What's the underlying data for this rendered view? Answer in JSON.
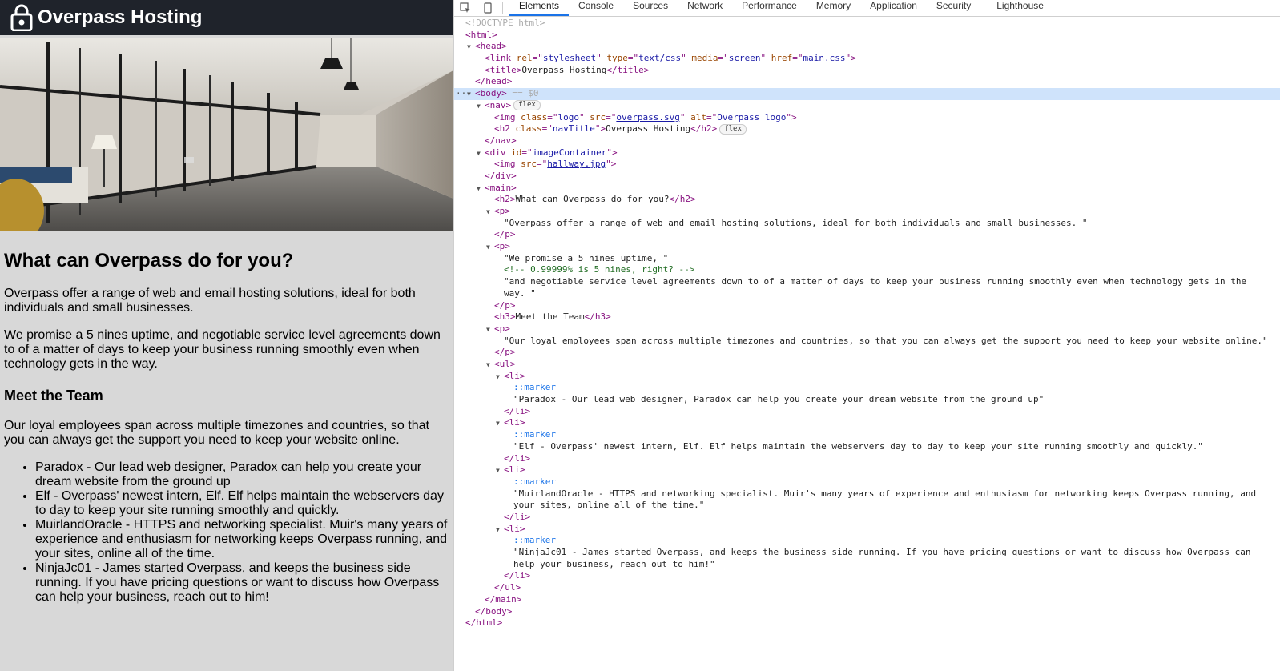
{
  "site": {
    "nav_title": "Overpass Hosting",
    "heading": "What can Overpass do for you?",
    "intro": "Overpass offer a range of web and email hosting solutions, ideal for both individuals and small businesses.",
    "promise": "We promise a 5 nines uptime, and negotiable service level agreements down to of a matter of days to keep your business running smoothly even when technology gets in the way.",
    "team_heading": "Meet the Team",
    "team_intro": "Our loyal employees span across multiple timezones and countries, so that you can always get the support you need to keep your website online.",
    "team": [
      "Paradox - Our lead web designer, Paradox can help you create your dream website from the ground up",
      "Elf - Overpass' newest intern, Elf. Elf helps maintain the webservers day to day to keep your site running smoothly and quickly.",
      "MuirlandOracle - HTTPS and networking specialist. Muir's many years of experience and enthusiasm for networking keeps Overpass running, and your sites, online all of the time.",
      "NinjaJc01 - James started Overpass, and keeps the business side running. If you have pricing questions or want to discuss how Overpass can help your business, reach out to him!"
    ]
  },
  "devtools": {
    "tabs": [
      "Elements",
      "Console",
      "Sources",
      "Network",
      "Performance",
      "Memory",
      "Application",
      "Security",
      "Lighthouse"
    ],
    "active_tab": "Elements",
    "doctype": "<!DOCTYPE html>",
    "head_link": {
      "rel": "stylesheet",
      "type": "text/css",
      "media": "screen",
      "href": "main.css"
    },
    "head_title": "Overpass Hosting",
    "body_marker": "== $0",
    "flex_badge": "flex",
    "img_logo": {
      "class": "logo",
      "src": "overpass.svg",
      "alt": "Overpass logo"
    },
    "nav_title_class": "navTitle",
    "nav_title_text": "Overpass Hosting",
    "image_container_id": "imageContainer",
    "hallway_src": "hallway.jpg",
    "h2_text": "What can Overpass do for you?",
    "p1_text": "\"Overpass offer a range of web and email hosting solutions, ideal for both individuals and small businesses. \"",
    "p2_text_a": "\"We promise a 5 nines uptime, \"",
    "p2_comment": "<!-- 0.99999% is 5 nines, right? -->",
    "p2_text_b": "\"and negotiable service level agreements down to of a matter of days to keep your business running smoothly even when technology gets in the way. \"",
    "h3_text": "Meet the Team",
    "p3_text": "\"Our loyal employees span across multiple timezones and countries, so that you can always get the support you need to keep your website online.\"",
    "marker": "::marker",
    "li_texts": [
      "\"Paradox - Our lead web designer, Paradox can help you create your dream website from the ground up\"",
      "\"Elf - Overpass' newest intern, Elf. Elf helps maintain the webservers day to day to keep your site running smoothly and quickly.\"",
      "\"MuirlandOracle - HTTPS and networking specialist. Muir's many years of experience and enthusiasm for networking keeps Overpass running, and your sites, online all of the time.\"",
      "\"NinjaJc01 - James started Overpass, and keeps the business side running. If you have pricing questions or want to discuss how Overpass can help your business, reach out to him!\""
    ]
  }
}
